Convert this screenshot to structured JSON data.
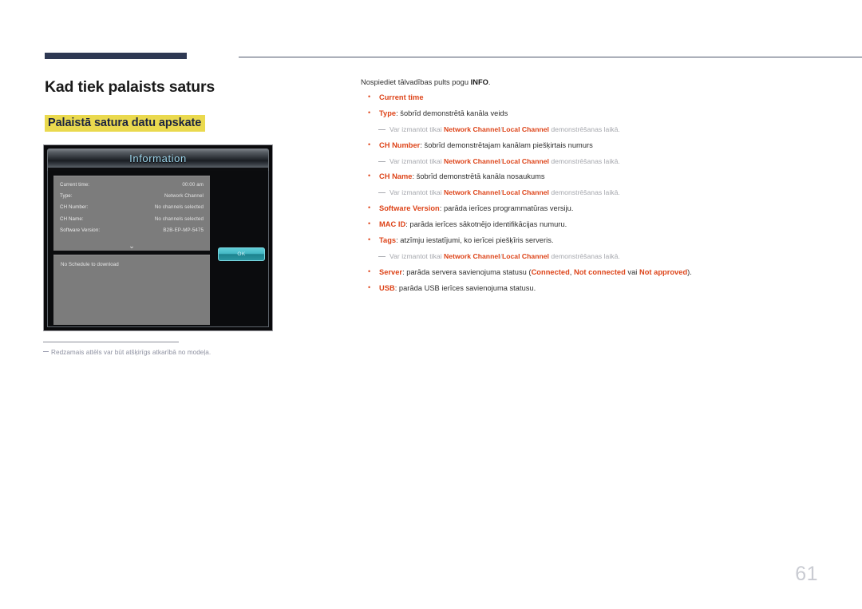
{
  "document": {
    "page_number": "61"
  },
  "heading": {
    "title": "Kad tiek palaists saturs",
    "subtitle": "Palaistā satura datu apskate"
  },
  "figure": {
    "dialog": {
      "title": "Information",
      "ok_label": "OK",
      "scroll_icon": "chevron-down-icon",
      "rows": [
        {
          "label": "Current time:",
          "value": "00:00 am"
        },
        {
          "label": "Type:",
          "value": "Network Channel"
        },
        {
          "label": "CH Number:",
          "value": "No channels selected"
        },
        {
          "label": "CH Name:",
          "value": "No channels selected"
        },
        {
          "label": "Software Version:",
          "value": "B2B-EP-MP-5475"
        }
      ],
      "schedule_text": "No Schedule to download"
    },
    "note": "Redzamais attēls var būt atšķirīgs atkarībā no modeļa."
  },
  "content": {
    "lead_before": "Nospiediet tālvadības pults pogu ",
    "lead_bold": "INFO",
    "lead_after": ".",
    "repeat_note": {
      "before": "Var izmantot tikai ",
      "term1": "Network Channel",
      "separator": "/",
      "term2": "Local Channel",
      "after": " demonstrēšanas laikā."
    },
    "items": [
      {
        "term": "Current time",
        "desc": ""
      },
      {
        "term": "Type",
        "desc": ": šobrīd demonstrētā kanāla veids"
      },
      {
        "term": "CH Number",
        "desc": ": šobrīd demonstrētajam kanālam piešķirtais numurs"
      },
      {
        "term": "CH Name",
        "desc": ": šobrīd demonstrētā kanāla nosaukums"
      },
      {
        "term": "Software Version",
        "desc": ": parāda ierīces programmatūras versiju."
      },
      {
        "term": "MAC ID",
        "desc": ": parāda ierīces sākotnējo identifikācijas numuru."
      },
      {
        "term": "Tags",
        "desc": ": atzīmju iestatījumi, ko ierīcei piešķīris serveris."
      },
      {
        "term": "USB",
        "desc": ": parāda USB ierīces savienojuma statusu."
      }
    ],
    "server_item": {
      "term": "Server",
      "mid": ": parāda servera savienojuma statusu (",
      "status1": "Connected",
      "sep1": ", ",
      "status2": "Not connected",
      "sep2": " vai ",
      "status3": "Not approved",
      "tail": ")."
    }
  },
  "colors": {
    "accent_red": "#dd4318",
    "highlight_yellow": "#ead94e",
    "header_navy": "#2e3953",
    "note_grey": "#a5a7ad",
    "ok_button_teal": "#45b9c6"
  }
}
